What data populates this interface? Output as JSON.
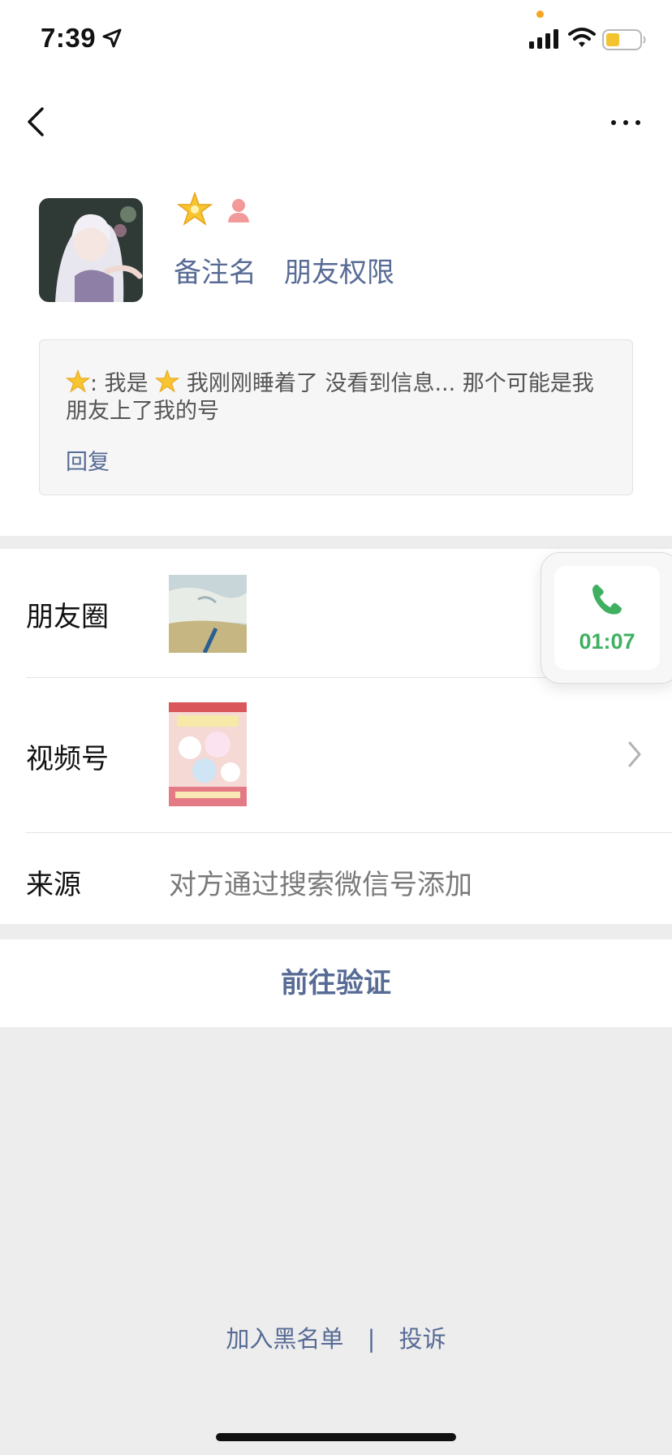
{
  "status_bar": {
    "time": "7:39"
  },
  "profile": {
    "remark_link": "备注名",
    "permission_link": "朋友权限"
  },
  "greeting": {
    "text_prefix": ": 我是",
    "text_body": " 我刚刚睡着了 没看到信息... 那个可能是我朋友上了我的号",
    "reply_label": "回复"
  },
  "rows": {
    "moments_label": "朋友圈",
    "channels_label": "视频号",
    "source_label": "来源",
    "source_value": "对方通过搜索微信号添加"
  },
  "actions": {
    "verify_label": "前往验证"
  },
  "call": {
    "timer": "01:07"
  },
  "footer": {
    "blacklist_label": "加入黑名单",
    "separator": "|",
    "report_label": "投诉"
  },
  "colors": {
    "link": "#576b95",
    "call_green": "#3fb060",
    "page_bg": "#ededed"
  }
}
